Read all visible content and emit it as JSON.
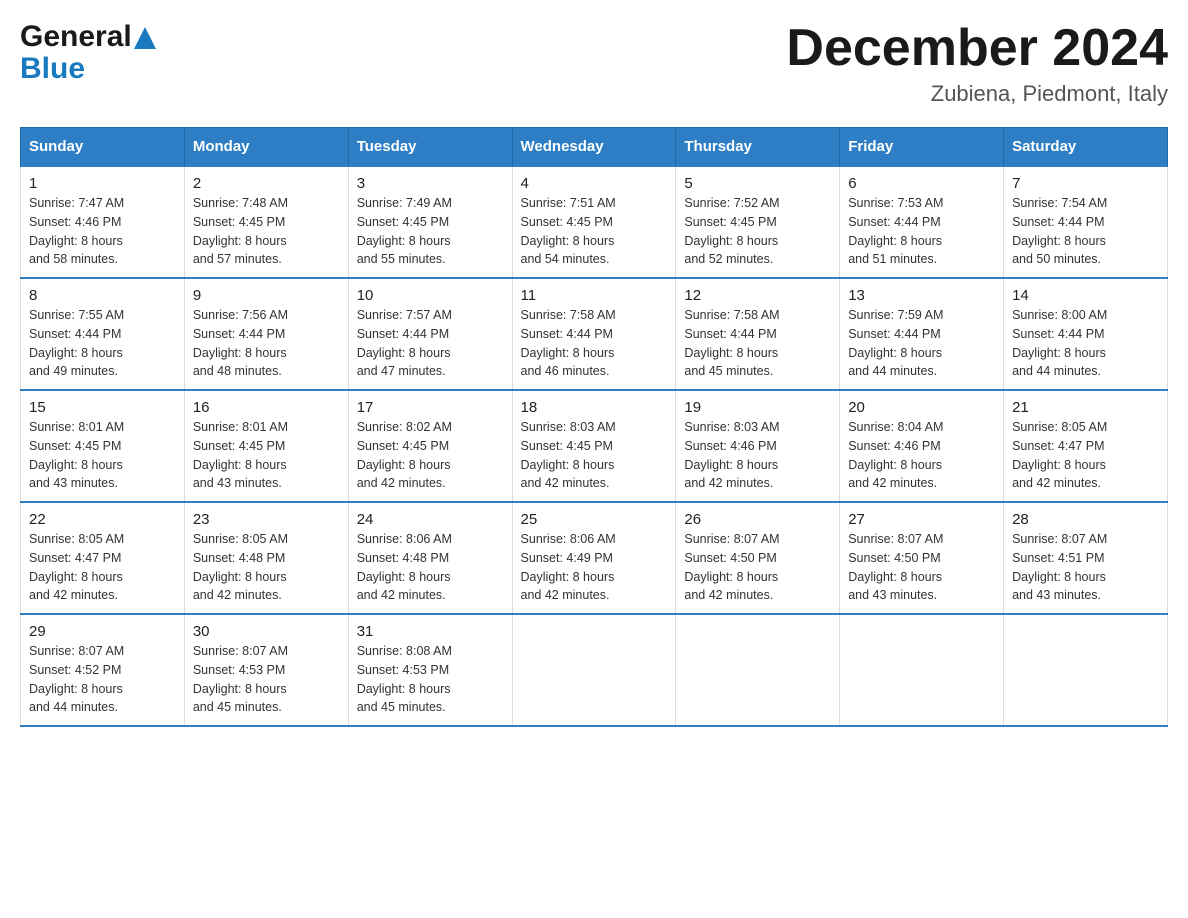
{
  "header": {
    "logo": {
      "general": "General",
      "blue": "Blue",
      "alt": "GeneralBlue logo"
    },
    "title": "December 2024",
    "location": "Zubiena, Piedmont, Italy"
  },
  "calendar": {
    "days_of_week": [
      "Sunday",
      "Monday",
      "Tuesday",
      "Wednesday",
      "Thursday",
      "Friday",
      "Saturday"
    ],
    "weeks": [
      [
        {
          "day": "1",
          "sunrise": "7:47 AM",
          "sunset": "4:46 PM",
          "daylight": "8 hours and 58 minutes."
        },
        {
          "day": "2",
          "sunrise": "7:48 AM",
          "sunset": "4:45 PM",
          "daylight": "8 hours and 57 minutes."
        },
        {
          "day": "3",
          "sunrise": "7:49 AM",
          "sunset": "4:45 PM",
          "daylight": "8 hours and 55 minutes."
        },
        {
          "day": "4",
          "sunrise": "7:51 AM",
          "sunset": "4:45 PM",
          "daylight": "8 hours and 54 minutes."
        },
        {
          "day": "5",
          "sunrise": "7:52 AM",
          "sunset": "4:45 PM",
          "daylight": "8 hours and 52 minutes."
        },
        {
          "day": "6",
          "sunrise": "7:53 AM",
          "sunset": "4:44 PM",
          "daylight": "8 hours and 51 minutes."
        },
        {
          "day": "7",
          "sunrise": "7:54 AM",
          "sunset": "4:44 PM",
          "daylight": "8 hours and 50 minutes."
        }
      ],
      [
        {
          "day": "8",
          "sunrise": "7:55 AM",
          "sunset": "4:44 PM",
          "daylight": "8 hours and 49 minutes."
        },
        {
          "day": "9",
          "sunrise": "7:56 AM",
          "sunset": "4:44 PM",
          "daylight": "8 hours and 48 minutes."
        },
        {
          "day": "10",
          "sunrise": "7:57 AM",
          "sunset": "4:44 PM",
          "daylight": "8 hours and 47 minutes."
        },
        {
          "day": "11",
          "sunrise": "7:58 AM",
          "sunset": "4:44 PM",
          "daylight": "8 hours and 46 minutes."
        },
        {
          "day": "12",
          "sunrise": "7:58 AM",
          "sunset": "4:44 PM",
          "daylight": "8 hours and 45 minutes."
        },
        {
          "day": "13",
          "sunrise": "7:59 AM",
          "sunset": "4:44 PM",
          "daylight": "8 hours and 44 minutes."
        },
        {
          "day": "14",
          "sunrise": "8:00 AM",
          "sunset": "4:44 PM",
          "daylight": "8 hours and 44 minutes."
        }
      ],
      [
        {
          "day": "15",
          "sunrise": "8:01 AM",
          "sunset": "4:45 PM",
          "daylight": "8 hours and 43 minutes."
        },
        {
          "day": "16",
          "sunrise": "8:01 AM",
          "sunset": "4:45 PM",
          "daylight": "8 hours and 43 minutes."
        },
        {
          "day": "17",
          "sunrise": "8:02 AM",
          "sunset": "4:45 PM",
          "daylight": "8 hours and 42 minutes."
        },
        {
          "day": "18",
          "sunrise": "8:03 AM",
          "sunset": "4:45 PM",
          "daylight": "8 hours and 42 minutes."
        },
        {
          "day": "19",
          "sunrise": "8:03 AM",
          "sunset": "4:46 PM",
          "daylight": "8 hours and 42 minutes."
        },
        {
          "day": "20",
          "sunrise": "8:04 AM",
          "sunset": "4:46 PM",
          "daylight": "8 hours and 42 minutes."
        },
        {
          "day": "21",
          "sunrise": "8:05 AM",
          "sunset": "4:47 PM",
          "daylight": "8 hours and 42 minutes."
        }
      ],
      [
        {
          "day": "22",
          "sunrise": "8:05 AM",
          "sunset": "4:47 PM",
          "daylight": "8 hours and 42 minutes."
        },
        {
          "day": "23",
          "sunrise": "8:05 AM",
          "sunset": "4:48 PM",
          "daylight": "8 hours and 42 minutes."
        },
        {
          "day": "24",
          "sunrise": "8:06 AM",
          "sunset": "4:48 PM",
          "daylight": "8 hours and 42 minutes."
        },
        {
          "day": "25",
          "sunrise": "8:06 AM",
          "sunset": "4:49 PM",
          "daylight": "8 hours and 42 minutes."
        },
        {
          "day": "26",
          "sunrise": "8:07 AM",
          "sunset": "4:50 PM",
          "daylight": "8 hours and 42 minutes."
        },
        {
          "day": "27",
          "sunrise": "8:07 AM",
          "sunset": "4:50 PM",
          "daylight": "8 hours and 43 minutes."
        },
        {
          "day": "28",
          "sunrise": "8:07 AM",
          "sunset": "4:51 PM",
          "daylight": "8 hours and 43 minutes."
        }
      ],
      [
        {
          "day": "29",
          "sunrise": "8:07 AM",
          "sunset": "4:52 PM",
          "daylight": "8 hours and 44 minutes."
        },
        {
          "day": "30",
          "sunrise": "8:07 AM",
          "sunset": "4:53 PM",
          "daylight": "8 hours and 45 minutes."
        },
        {
          "day": "31",
          "sunrise": "8:08 AM",
          "sunset": "4:53 PM",
          "daylight": "8 hours and 45 minutes."
        },
        null,
        null,
        null,
        null
      ]
    ],
    "labels": {
      "sunrise": "Sunrise:",
      "sunset": "Sunset:",
      "daylight": "Daylight:"
    }
  }
}
